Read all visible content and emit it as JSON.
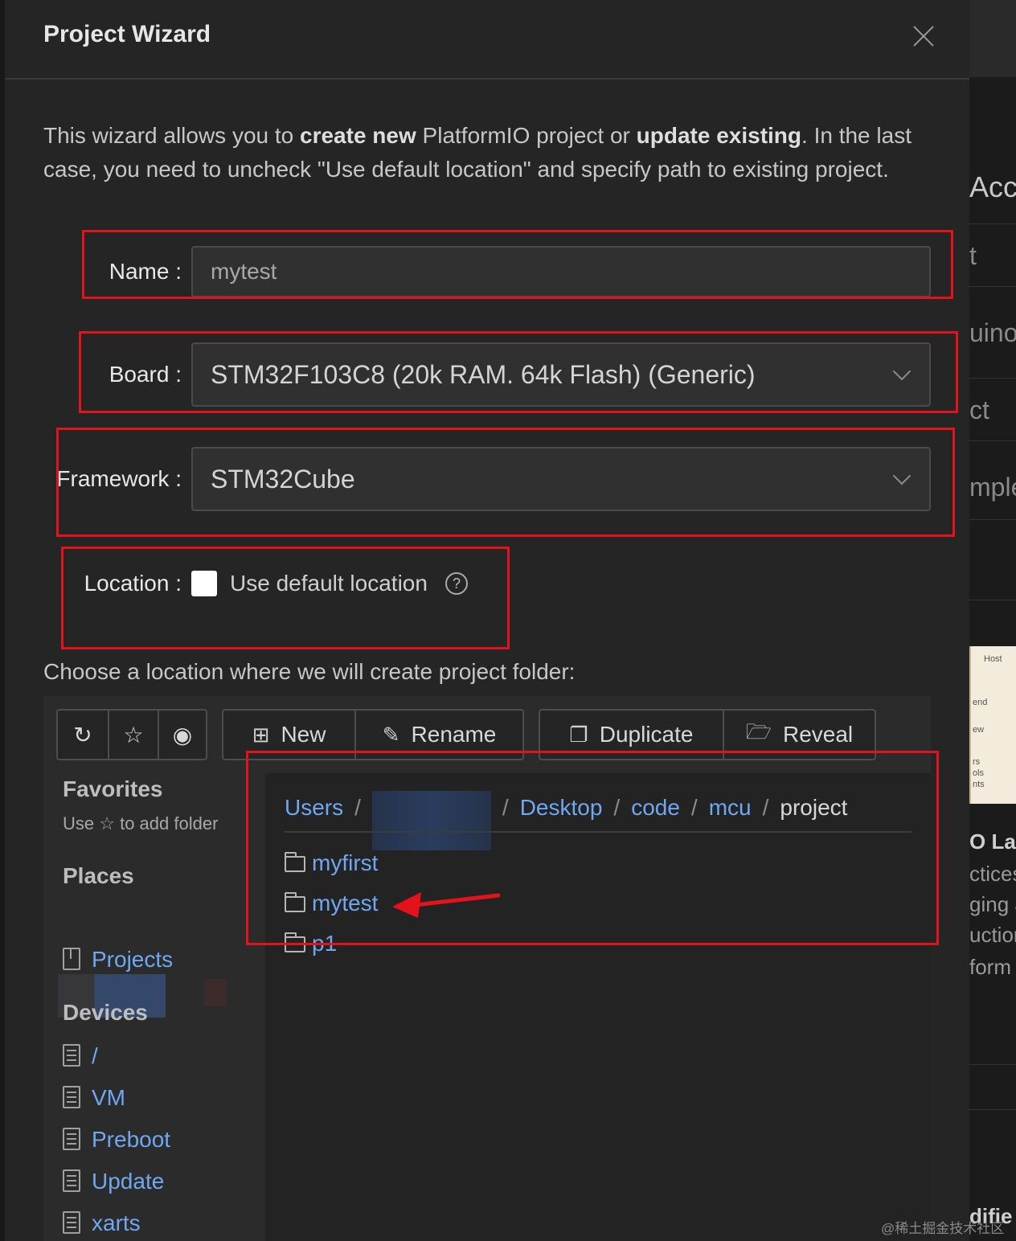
{
  "dialog": {
    "title": "Project Wizard",
    "intro": {
      "p1": "This wizard allows you to ",
      "b1": "create new",
      "p2": " PlatformIO project or ",
      "b2": "update existing",
      "p3": ". In the last case, you need to uncheck \"Use default location\" and specify path to existing project."
    }
  },
  "form": {
    "name_label": "Name :",
    "name_value": "mytest",
    "board_label": "Board :",
    "board_value": "STM32F103C8 (20k RAM. 64k Flash) (Generic)",
    "framework_label": "Framework :",
    "framework_value": "STM32Cube",
    "location_label": "Location :",
    "use_default_location": "Use default location",
    "use_default_checked": false,
    "help_glyph": "?"
  },
  "chooser": {
    "prompt": "Choose a location where we will create project folder:",
    "toolbar": {
      "refresh_icon": "↻",
      "favorite_icon": "☆",
      "show_hidden_icon": "◉",
      "new_label": "New",
      "rename_label": "Rename",
      "duplicate_label": "Duplicate",
      "reveal_label": "Reveal"
    },
    "sidebar": {
      "favorites_heading": "Favorites",
      "favorites_hint_pre": "Use ",
      "favorites_hint_star": "☆",
      "favorites_hint_post": " to add folder",
      "places_heading": "Places",
      "places": [
        "Projects"
      ],
      "devices_heading": "Devices",
      "devices": [
        "/",
        "VM",
        "Preboot",
        "Update",
        "xarts"
      ]
    },
    "breadcrumb": [
      "Users",
      "Desktop",
      "code",
      "mcu",
      "project"
    ],
    "breadcrumb_sep": "/",
    "folders": [
      "myfirst",
      "mytest",
      "p1"
    ]
  },
  "background": {
    "fragments": [
      "Acc",
      "t",
      "uino",
      "ct",
      "mple",
      "O Lab",
      "ctices",
      "ging a",
      "uction",
      "form",
      "difie"
    ],
    "thumb_labels": [
      "Host",
      "end",
      "ew",
      "rs",
      "ols",
      "nts"
    ]
  },
  "watermark": "@稀土掘金技术社区",
  "colors": {
    "annotation": "#e4121b",
    "link": "#6fa8f0",
    "dialog_bg": "#252526"
  }
}
